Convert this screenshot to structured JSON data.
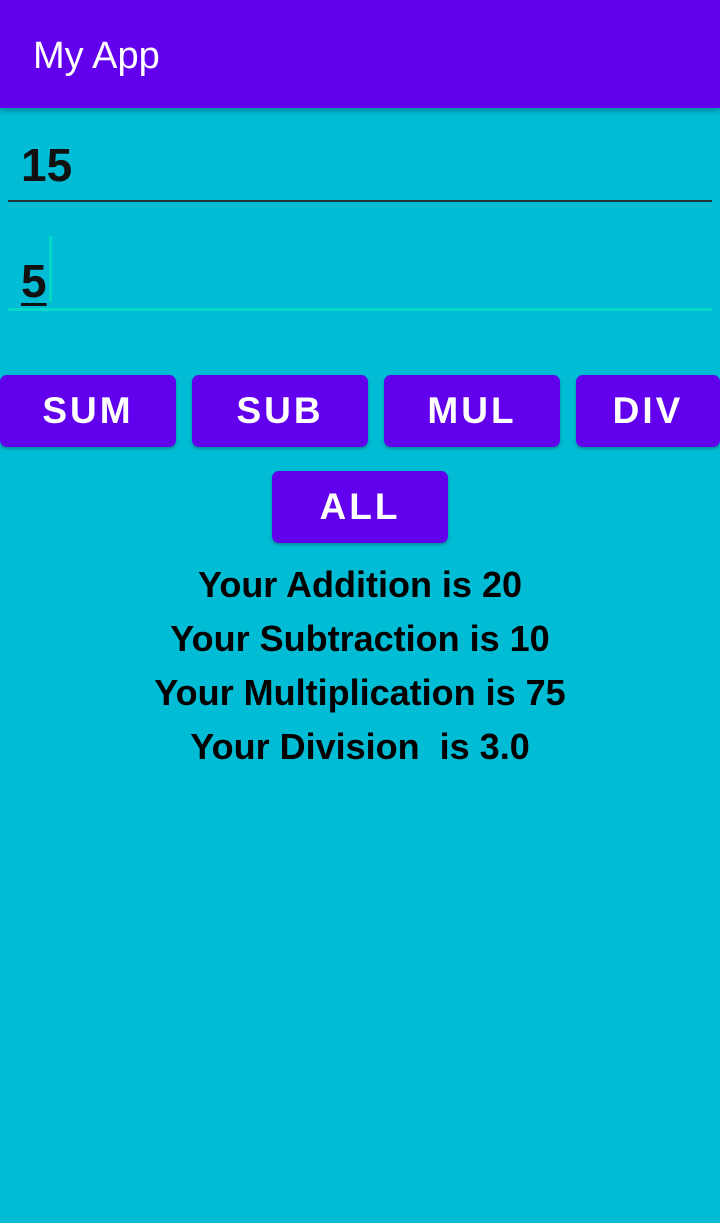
{
  "app_bar": {
    "title": "My App"
  },
  "inputs": {
    "first_value": "15",
    "second_value": "5"
  },
  "buttons": {
    "sum": "SUM",
    "sub": "SUB",
    "mul": "MUL",
    "div": "DIV",
    "all": "ALL"
  },
  "results": {
    "addition": "Your Addition is 20",
    "subtraction": "Your Subtraction is 10",
    "multiplication": "Your Multiplication is 75",
    "division": "Your Division  is 3.0"
  },
  "colors": {
    "app_bar": "#6200ee",
    "background": "#00bcd4",
    "button": "#6200ee",
    "focus_accent": "#03dac5"
  }
}
